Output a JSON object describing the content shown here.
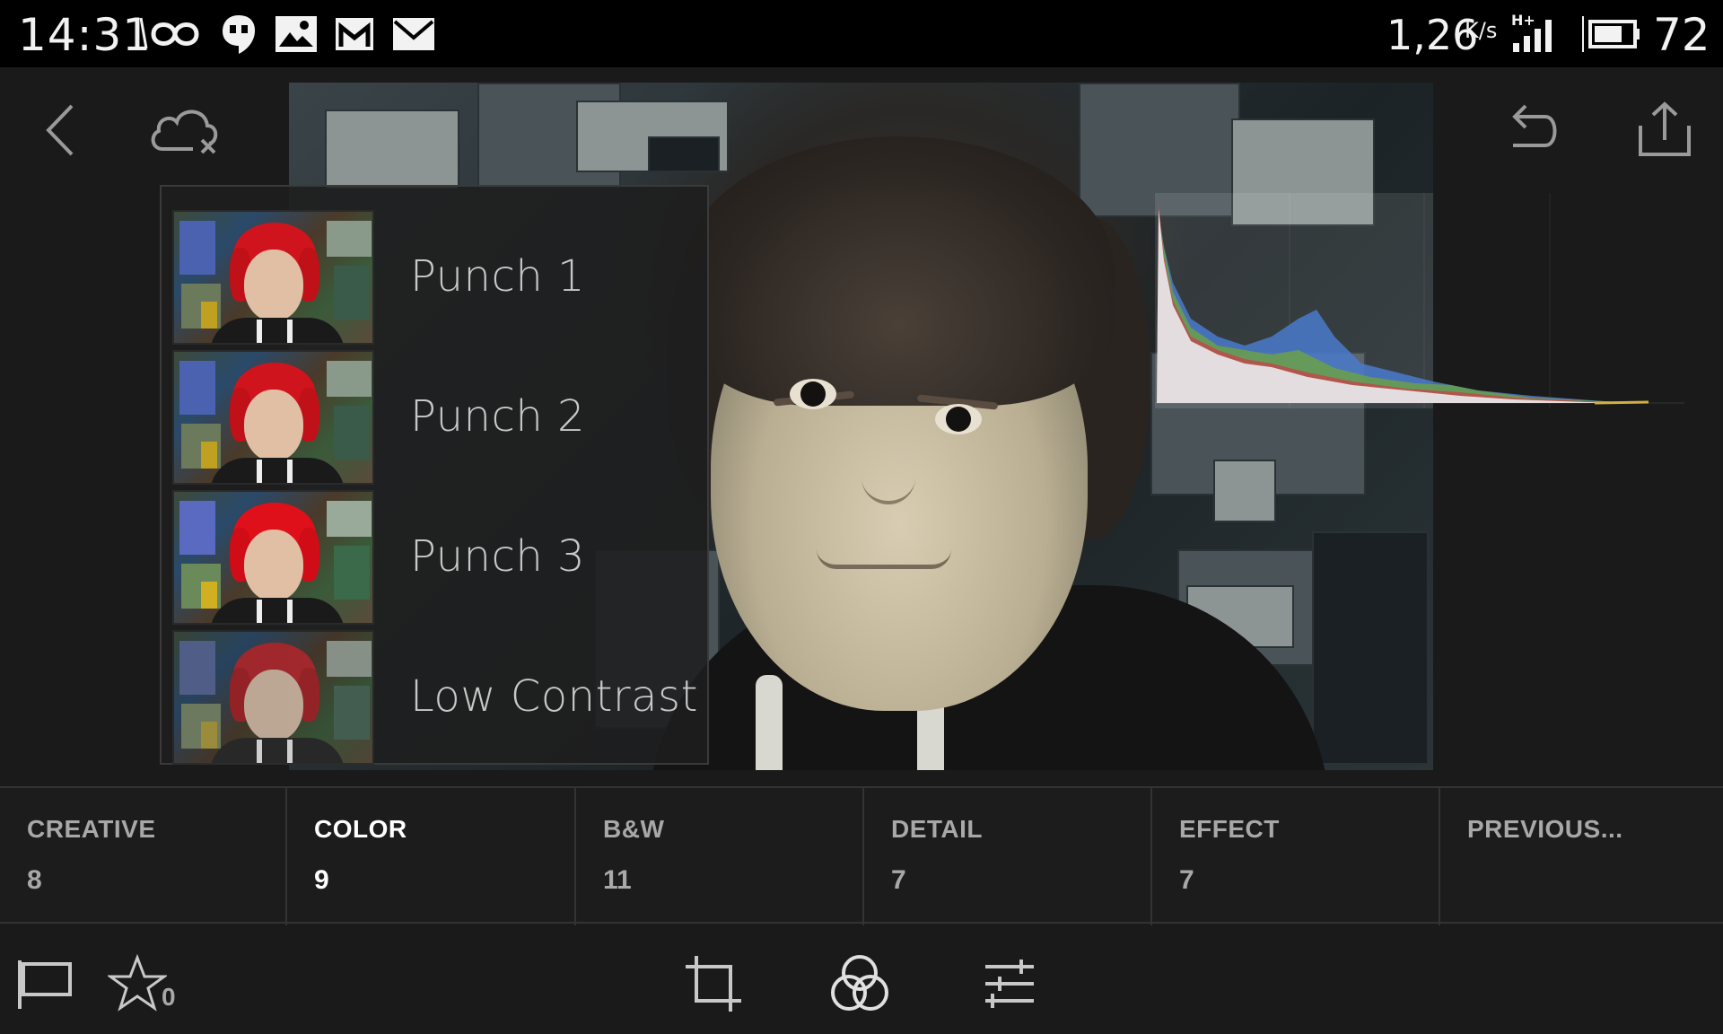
{
  "status_bar": {
    "time": "14:31",
    "speed_value": "1,26",
    "speed_unit": "K/s",
    "network": "H+",
    "battery_percent": "72"
  },
  "toolbar": {
    "back_icon": "chevron-left-icon",
    "cloud_icon": "cloud-off-icon",
    "undo_icon": "undo-icon",
    "share_icon": "share-icon"
  },
  "presets": [
    {
      "label": "Punch 1"
    },
    {
      "label": "Punch 2"
    },
    {
      "label": "Punch 3"
    },
    {
      "label": "Low Contrast"
    }
  ],
  "tabs": [
    {
      "name": "CREATIVE",
      "count": "8",
      "active": false
    },
    {
      "name": "COLOR",
      "count": "9",
      "active": true
    },
    {
      "name": "B&W",
      "count": "11",
      "active": false
    },
    {
      "name": "DETAIL",
      "count": "7",
      "active": false
    },
    {
      "name": "EFFECT",
      "count": "7",
      "active": false
    },
    {
      "name": "PREVIOUS...",
      "count": "",
      "active": false
    }
  ],
  "bottom_toolbar": {
    "flag_icon": "flag-icon",
    "star_icon": "star-icon",
    "star_count": "0",
    "crop_icon": "crop-icon",
    "presets_icon": "presets-circles-icon",
    "adjust_icon": "sliders-icon"
  },
  "colors": {
    "background": "#1a1a1a",
    "active_tab_text": "#ffffff",
    "inactive_tab_text": "#a8a8a8",
    "histogram_blue": "#4a7acc",
    "histogram_green": "#6aa04a",
    "histogram_red": "#c04a4a"
  }
}
